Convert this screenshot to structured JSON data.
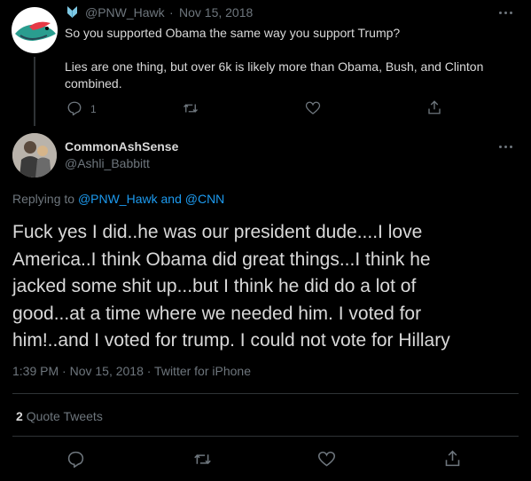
{
  "parent_tweet": {
    "handle": "@PNW_Hawk",
    "separator": "·",
    "date": "Nov 15, 2018",
    "line1": "So you supported Obama the same way you support Trump?",
    "line2": "Lies are one thing, but over 6k is likely more than Obama, Bush, and Clinton",
    "line3": "combined.",
    "reply_count": "1",
    "badge_color": "#7ec8e3"
  },
  "main_tweet": {
    "display_name": "CommonAshSense",
    "handle": "@Ashli_Babbitt",
    "replying_prefix": "Replying to",
    "replying_handles": "@PNW_Hawk and @CNN",
    "text_lines": [
      "Fuck yes I did..he was our president dude....I love",
      "America..I think Obama did great things...I think he",
      "jacked some shit up...but I think he did do a lot of",
      "good...at a time where we needed him.  I voted for",
      "him!..and I voted for trump.  I could not vote for Hillary"
    ],
    "meta": "1:39 PM · Nov 15, 2018 · Twitter for iPhone",
    "quote_count": "2",
    "quote_label": "Quote Tweets"
  },
  "colors": {
    "background": "#000000",
    "text": "#d9d9d9",
    "muted": "#6e767d",
    "link": "#1d9bf0",
    "divider": "#2f3336"
  },
  "icons": [
    "reply-icon",
    "retweet-icon",
    "like-icon",
    "share-icon",
    "more-icon",
    "verified-badge-icon"
  ]
}
